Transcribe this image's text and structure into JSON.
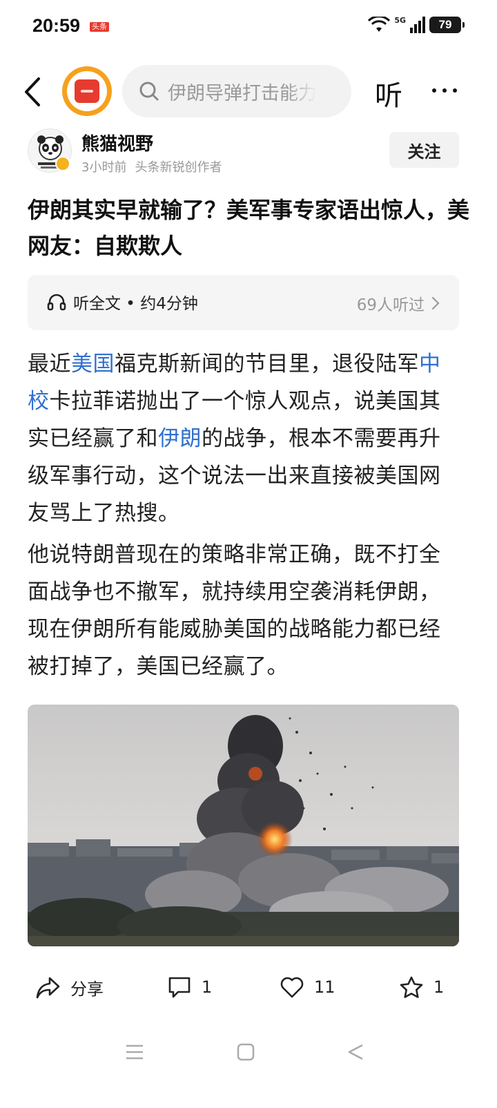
{
  "status_bar": {
    "time": "20:59",
    "app_badge": "头条",
    "network": "5G",
    "battery": "79"
  },
  "nav": {
    "search_placeholder": "伊朗导弹打击能力",
    "listen_label": "听",
    "icons": [
      "back-arrow-icon",
      "toutiao-logo-icon",
      "search-icon",
      "more-icon"
    ]
  },
  "author": {
    "name": "熊猫视野",
    "time": "3小时前",
    "tag": "头条新锐创作者",
    "follow_label": "关注"
  },
  "article": {
    "title": "伊朗其实早就输了？美军事专家语出惊人，美网友：自欺欺人",
    "audio": {
      "label": "听全文 • 约4分钟",
      "listeners": "69人听过"
    },
    "para1": {
      "t1": "最近",
      "link1": "美国",
      "t2": "福克斯新闻的节目里，退役陆军",
      "link2": "中校",
      "t3": "卡拉菲诺抛出了一个惊人观点，说美国其实已经赢了和",
      "link3": "伊朗",
      "t4": "的战争，根本不需要再升级军事行动，这个说法一出来直接被美国网友骂上了热搜。"
    },
    "para2": "他说特朗普现在的策略非常正确，既不打全面战争也不撤军，就持续用空袭消耗伊朗，现在伊朗所有能威胁美国的战略能力都已经被打掉了，美国已经赢了。"
  },
  "actions": {
    "share_label": "分享",
    "comment_count": "1",
    "like_count": "11",
    "star_count": "1"
  },
  "colors": {
    "link": "#3070d0",
    "logo_orange": "#f6a11d",
    "logo_red": "#e63b2e"
  }
}
